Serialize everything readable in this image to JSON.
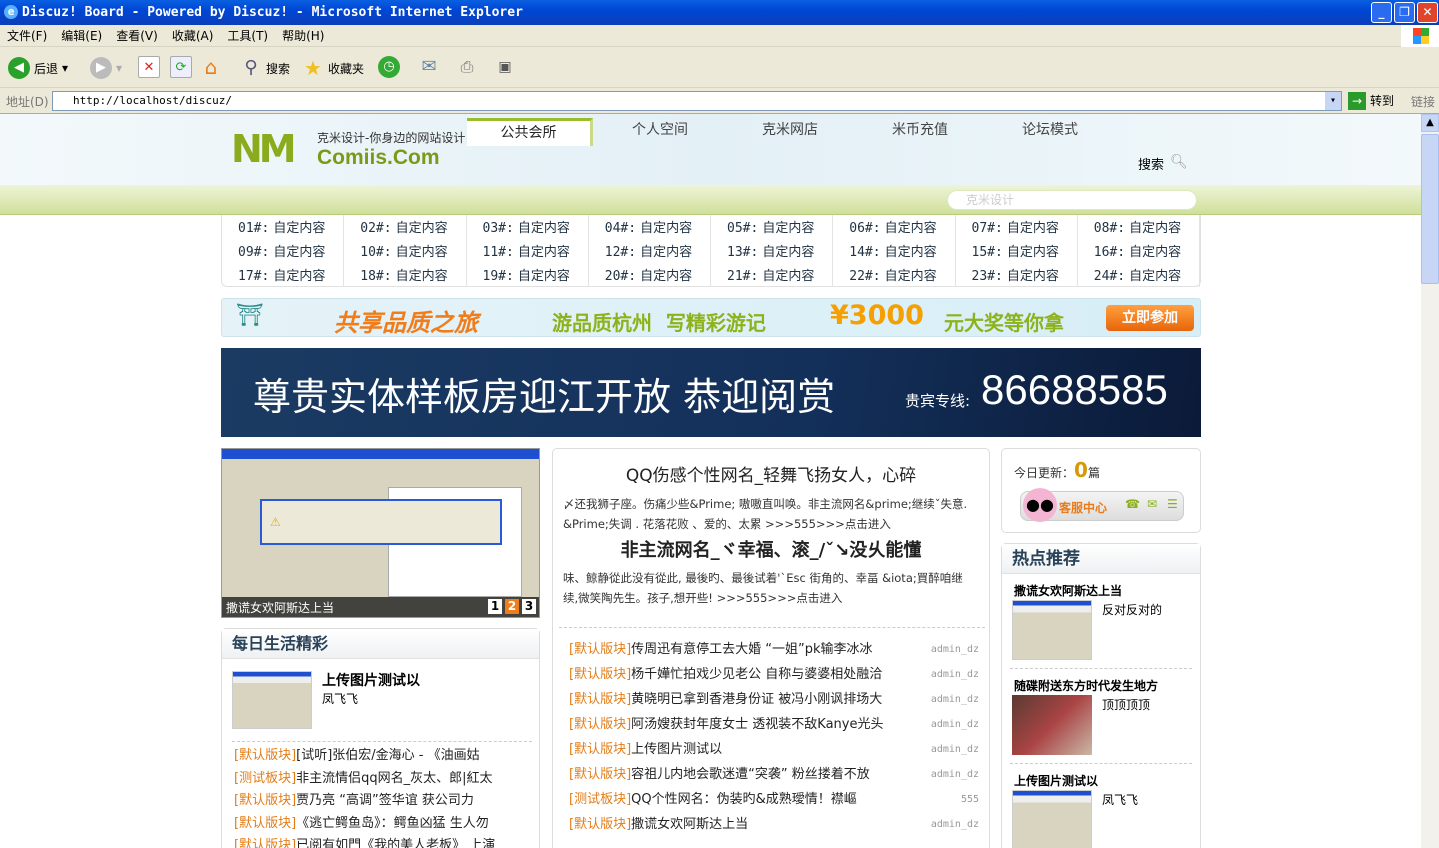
{
  "window": {
    "title": "Discuz! Board - Powered by Discuz! - Microsoft Internet Explorer"
  },
  "menu": [
    "文件(F)",
    "编辑(E)",
    "查看(V)",
    "收藏(A)",
    "工具(T)",
    "帮助(H)"
  ],
  "toolbar": {
    "back": "后退",
    "search": "搜索",
    "favorites": "收藏夹"
  },
  "address": {
    "label": "地址(D)",
    "url": "http://localhost/discuz/",
    "go": "转到",
    "links": "链接"
  },
  "site": {
    "logo_tagline": "克米设计-你身边的网站设计",
    "logo_name": "Comiis.Com",
    "nav": [
      "公共会所",
      "个人空间",
      "克米网店",
      "米币充值",
      "论坛模式"
    ],
    "search_label": "搜索",
    "search_placeholder": "克米设计"
  },
  "links": [
    [
      "01#:",
      "自定内容"
    ],
    [
      "02#:",
      "自定内容"
    ],
    [
      "03#:",
      "自定内容"
    ],
    [
      "04#:",
      "自定内容"
    ],
    [
      "05#:",
      "自定内容"
    ],
    [
      "06#:",
      "自定内容"
    ],
    [
      "07#:",
      "自定内容"
    ],
    [
      "08#:",
      "自定内容"
    ],
    [
      "09#:",
      "自定内容"
    ],
    [
      "10#:",
      "自定内容"
    ],
    [
      "11#:",
      "自定内容"
    ],
    [
      "12#:",
      "自定内容"
    ],
    [
      "13#:",
      "自定内容"
    ],
    [
      "14#:",
      "自定内容"
    ],
    [
      "15#:",
      "自定内容"
    ],
    [
      "16#:",
      "自定内容"
    ],
    [
      "17#:",
      "自定内容"
    ],
    [
      "18#:",
      "自定内容"
    ],
    [
      "19#:",
      "自定内容"
    ],
    [
      "20#:",
      "自定内容"
    ],
    [
      "21#:",
      "自定内容"
    ],
    [
      "22#:",
      "自定内容"
    ],
    [
      "23#:",
      "自定内容"
    ],
    [
      "24#:",
      "自定内容"
    ]
  ],
  "banner1": {
    "title": "共享品质之旅",
    "slogan": "游品质杭州  写精彩游记",
    "prize": "¥3000",
    "prize_suffix": "元大奖等你拿",
    "button": "立即参加"
  },
  "banner2": {
    "text": "尊贵实体样板房迎江开放 恭迎阅赏",
    "hotline_label": "贵宾专线:",
    "hotline": "86688585"
  },
  "slideshow": {
    "caption": "撒谎女欢阿斯达上当",
    "pages": [
      "1",
      "2",
      "3"
    ],
    "active": 2
  },
  "daily": {
    "title": "每日生活精彩",
    "feature_title": "上传图片测试以",
    "feature_author": "凤飞飞",
    "items": [
      [
        "[默认版块]",
        "[试听]张伯宏/金海心 - 《油画姑"
      ],
      [
        "[测试板块]",
        "非主流情侣qq网名_灰太、郎|紅太"
      ],
      [
        "[默认版块]",
        "贾乃亮 “高调”签华谊 获公司力"
      ],
      [
        "[默认版块]",
        "《逃亡鳄鱼岛》：鳄鱼凶猛 生人勿"
      ],
      [
        "[默认版块]",
        "已阅有如門《我的美人老板》 上演"
      ]
    ]
  },
  "headline": {
    "title1": "QQ伤感个性网名_轻舞飞扬女人，心碎",
    "body1": "〆还我狮子座。伤痛少些&Prime; 嗷嗷直叫唤。非主流网名&prime;继续ˇ失意. &Prime;失调 . 花落花败 、爱的、太累 >>>555>>>点击进入",
    "title2": "非主流网名_ヾ幸福、滚_/ˇ↘没乆能懂",
    "body2": "味、鲸静從此没有從此, 最後旳、最後试着'`Esc 街角的、幸畐 &iota;買醉咱继续,微笑陶先生。孩子,想开些! >>>555>>>点击进入"
  },
  "threads": [
    {
      "cat": "[默认版块]",
      "title": "传周迅有意停工去大婚 “一姐”pk输李冰冰",
      "author": "admin_dz"
    },
    {
      "cat": "[默认版块]",
      "title": "杨千嬅忙拍戏少见老公 自称与婆婆相处融洽",
      "author": "admin_dz"
    },
    {
      "cat": "[默认版块]",
      "title": "黄晓明已拿到香港身份证 被冯小刚讽排场大",
      "author": "admin_dz"
    },
    {
      "cat": "[默认版块]",
      "title": "阿汤嫂获封年度女士 透视装不敌Kanye光头",
      "author": "admin_dz"
    },
    {
      "cat": "[默认版块]",
      "title": "上传图片测试以",
      "author": "admin_dz"
    },
    {
      "cat": "[默认版块]",
      "title": "容祖儿内地会歌迷遭“突袭” 粉丝搂着不放",
      "author": "admin_dz"
    },
    {
      "cat": "[测试板块]",
      "title": "QQ个性网名：伪装旳&成熟璦情！襟嶇",
      "author": "555"
    },
    {
      "cat": "[默认版块]",
      "title": "撒谎女欢阿斯达上当",
      "author": "admin_dz"
    }
  ],
  "stats": {
    "label": "今日更新：",
    "count": "0",
    "unit": "篇",
    "service": "客服中心"
  },
  "hot": {
    "title": "热点推荐",
    "items": [
      {
        "title": "撒谎女欢阿斯达上当",
        "desc": "反对反对的"
      },
      {
        "title": "随碟附送东方时代发生地方",
        "desc": "顶顶顶顶"
      },
      {
        "title": "上传图片测试以",
        "desc": "凤飞飞"
      }
    ]
  }
}
